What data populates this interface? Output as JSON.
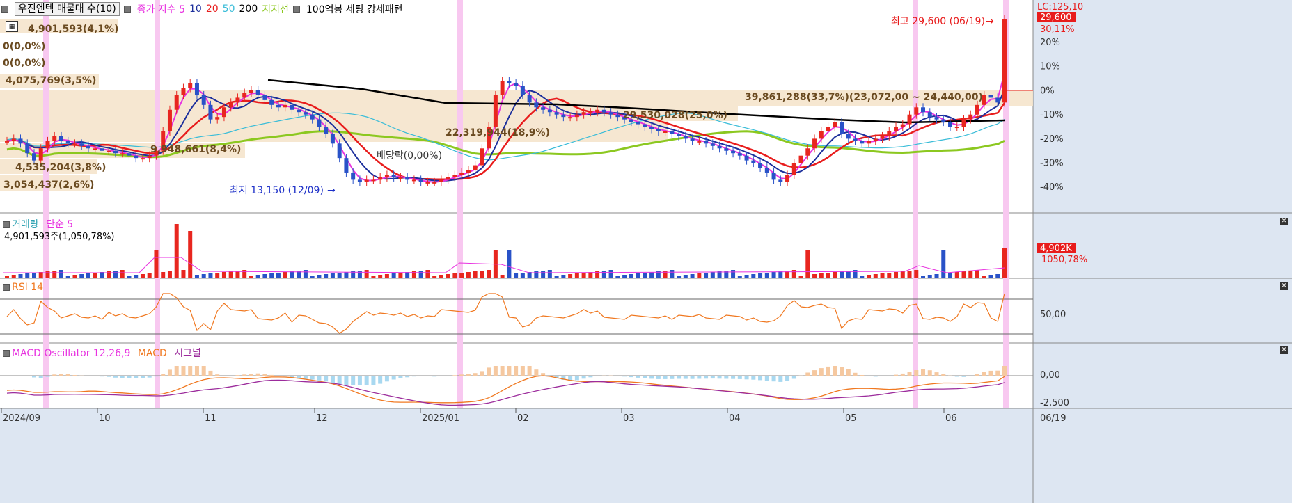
{
  "legend": {
    "stock_button": "우진엔텍 매물대 수(10)",
    "ma_title": "종가 지수 5",
    "ma_periods": [
      "10",
      "20",
      "50",
      "200"
    ],
    "support_line": "지지선",
    "pattern": "100억봉 세팅 강세패턴"
  },
  "price_panel": {
    "lc_label": "LC:125,10",
    "current_price_badge": "29,600",
    "current_pct_badge": "30,11%",
    "y_ticks": [
      "20%",
      "10%",
      "0%",
      "-10%",
      "-20%",
      "-30%",
      "-40%"
    ],
    "high_annotation": "최고 29,600 (06/19)",
    "low_annotation": "최저 13,150 (12/09)",
    "dividend_annotation": "배당락(0,00%)",
    "volume_profile_labels": [
      "4,901,593(4,1%)",
      "0(0,0%)",
      "0(0,0%)",
      "4,075,769(3,5%)",
      "39,861,288(33,7%)(23,072,00 ~ 24,440,00)",
      "29,530,028(25,0%)",
      "22,319,944(18,9%)",
      "9,948,661(8,4%)",
      "4,535,204(3,8%)",
      "3,054,437(2,6%)"
    ]
  },
  "volume_panel": {
    "title": "거래량",
    "ma_label": "단순 5",
    "value_label": "4,901,593주(1,050,78%)",
    "badge_value": "4,902K",
    "badge_pct": "1050,78%"
  },
  "rsi_panel": {
    "title": "RSI 14",
    "tick": "50,00"
  },
  "macd_panel": {
    "title": "MACD Oscillator 12,26,9",
    "macd_label": "MACD",
    "signal_label": "시그널",
    "ticks": [
      "0,00",
      "-2,500"
    ]
  },
  "x_axis": {
    "labels": [
      "2024/09",
      "10",
      "11",
      "12",
      "2025/01",
      "02",
      "03",
      "04",
      "05",
      "06"
    ],
    "end_label": "06/19"
  },
  "colors": {
    "up": "#e8261f",
    "down": "#2952c8",
    "ma5": "#e832e0",
    "ma10": "#1c2f9c",
    "ma20": "#e81c1c",
    "ma50": "#38bcd8",
    "ma200": "#000000",
    "support": "#8cc820",
    "highlight": "#f8c8f0",
    "profile": "#f5e4cc",
    "rsi": "#f07820",
    "macd": "#f07820",
    "signal": "#9c2c9c",
    "osc_pos": "#f5c8a0",
    "osc_neg": "#a8d8f0"
  },
  "chart_data": {
    "type": "candlestick",
    "price_axis": "percent change",
    "price_ylim": [
      -48,
      35
    ],
    "price_series_pct": [
      -21,
      -20,
      -22,
      -26,
      -29,
      -24,
      -21,
      -19,
      -21,
      -22,
      -22,
      -23,
      -24,
      -24,
      -25,
      -25,
      -26,
      -26,
      -27,
      -28,
      -28,
      -27,
      -25,
      -17,
      -8,
      -2,
      1,
      3,
      -2,
      -6,
      -12,
      -11,
      -7,
      -5,
      -3,
      -1,
      0,
      -2,
      -4,
      -6,
      -7,
      -6,
      -8,
      -9,
      -10,
      -12,
      -15,
      -18,
      -22,
      -28,
      -34,
      -37,
      -38,
      -37,
      -37,
      -36,
      -35,
      -36,
      -36,
      -37,
      -37,
      -38,
      -38,
      -38,
      -37,
      -36,
      -35,
      -34,
      -33,
      -31,
      -24,
      -15,
      -2,
      4,
      3,
      2,
      -2,
      -5,
      -7,
      -8,
      -9,
      -10,
      -11,
      -11,
      -10,
      -9,
      -9,
      -8,
      -9,
      -10,
      -11,
      -12,
      -13,
      -14,
      -15,
      -16,
      -17,
      -17,
      -18,
      -19,
      -20,
      -21,
      -21,
      -22,
      -23,
      -24,
      -25,
      -26,
      -27,
      -29,
      -30,
      -32,
      -34,
      -37,
      -38,
      -35,
      -30,
      -27,
      -24,
      -20,
      -17,
      -15,
      -13,
      -18,
      -20,
      -21,
      -22,
      -21,
      -20,
      -19,
      -17,
      -15,
      -14,
      -10,
      -7,
      -9,
      -11,
      -12,
      -13,
      -15,
      -15,
      -12,
      -10,
      -6,
      -2,
      -3,
      -5,
      29.6
    ],
    "x_labels": [
      "2024/09",
      "10",
      "11",
      "12",
      "2025/01",
      "02",
      "03",
      "04",
      "05",
      "06"
    ],
    "high": {
      "value": 29600,
      "date": "06/19"
    },
    "low": {
      "value": 13150,
      "date": "12/09"
    },
    "volume_spikes_index": [
      22,
      25,
      27,
      72,
      74,
      118,
      138,
      152,
      153
    ]
  }
}
